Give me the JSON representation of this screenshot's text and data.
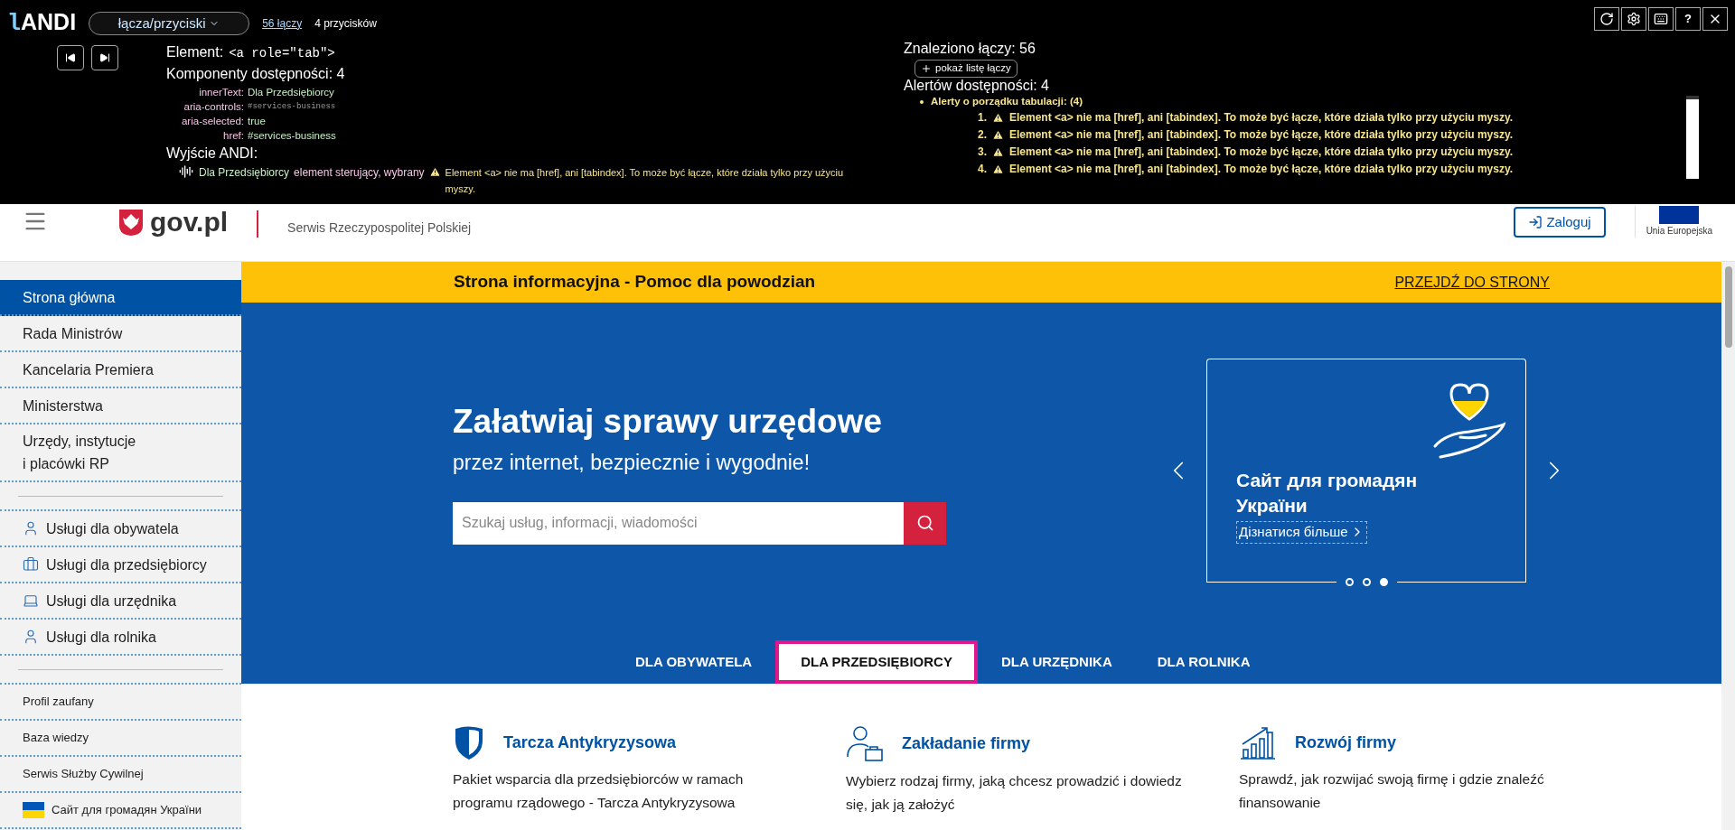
{
  "andi": {
    "logo_prefix": "l",
    "logo": "ANDI",
    "mode_dropdown": "łącza/przyciski",
    "links_count": "56 łączy",
    "buttons_count": "4 przycisków",
    "help_button": "?",
    "element_label": "Element:",
    "element_tag": "<a role=\"tab\">",
    "components_title": "Komponenty dostępności: 4",
    "properties": [
      {
        "name": "innerText:",
        "value": "Dla Przedsiębiorcy",
        "kind": "text"
      },
      {
        "name": "aria-controls:",
        "value": "#services-business",
        "kind": "code"
      },
      {
        "name": "aria-selected:",
        "value": "true",
        "kind": "text"
      },
      {
        "name": "href:",
        "value": "#services-business",
        "kind": "text"
      }
    ],
    "output_title": "Wyjście ANDI:",
    "output_name": "Dla Przedsiębiorcy",
    "output_role": "element sterujący, wybrany",
    "output_alert": "Element <a> nie ma [href], ani [tabindex]. To może być łącze, które działa tylko przy użyciu myszy.",
    "found": "Znaleziono łączy: 56",
    "show_list": "pokaż listę łączy",
    "alerts_title": "Alertów dostępności: 4",
    "alert_group": "Alerty o porządku tabulacji: (4)",
    "alerts": [
      {
        "number": "1.",
        "text": "Element <a> nie ma [href], ani [tabindex]. To może być łącze, które działa tylko przy użyciu myszy."
      },
      {
        "number": "2.",
        "text": "Element <a> nie ma [href], ani [tabindex]. To może być łącze, które działa tylko przy użyciu myszy."
      },
      {
        "number": "3.",
        "text": "Element <a> nie ma [href], ani [tabindex]. To może być łącze, które działa tylko przy użyciu myszy."
      },
      {
        "number": "4.",
        "text": "Element <a> nie ma [href], ani [tabindex]. To może być łącze, które działa tylko przy użyciu myszy."
      }
    ]
  },
  "header": {
    "logo": "gov.pl",
    "site_name": "Serwis Rzeczypospolitej Polskiej",
    "login": "Zaloguj",
    "eu": "Unia Europejska"
  },
  "sidebar": {
    "sections": [
      {
        "kind": "large",
        "items": [
          {
            "label": "Strona główna",
            "kind": "plain",
            "selected": true
          },
          {
            "label": "Rada Ministrów",
            "kind": "plain",
            "selected": false
          },
          {
            "label": "Kancelaria Premiera",
            "kind": "plain",
            "selected": false
          },
          {
            "label": "Ministerstwa",
            "kind": "plain",
            "selected": false
          },
          {
            "label": "Urzędy, instytucje\ni placówki RP",
            "kind": "plain",
            "selected": false
          }
        ]
      },
      {
        "kind": "large",
        "items": [
          {
            "label": "Usługi dla obywatela",
            "kind": "person",
            "selected": false
          },
          {
            "label": "Usługi dla przedsiębiorcy",
            "kind": "briefcase",
            "selected": false
          },
          {
            "label": "Usługi dla urzędnika",
            "kind": "laptop",
            "selected": false
          },
          {
            "label": "Usługi dla rolnika",
            "kind": "person",
            "selected": false
          }
        ]
      },
      {
        "kind": "small",
        "items": [
          {
            "label": "Profil zaufany",
            "kind": "plain",
            "selected": false
          },
          {
            "label": "Baza wiedzy",
            "kind": "plain",
            "selected": false
          },
          {
            "label": "Serwis Służby Cywilnej",
            "kind": "plain",
            "selected": false
          },
          {
            "label": "Сайт для громадян України",
            "kind": "flag",
            "selected": false
          }
        ]
      }
    ]
  },
  "banner": {
    "text": "Strona informacyjna - Pomoc dla powodzian",
    "link": "PRZEJDŹ DO STRONY"
  },
  "hero": {
    "title": "Załatwiaj sprawy urzędowe",
    "subtitle": "przez internet, bezpiecznie i wygodnie!",
    "search_placeholder": "Szukaj usług, informacji, wiadomości"
  },
  "carousel": {
    "title": "Сайт для громадян України",
    "link": "Дізнатися більше",
    "dots": [
      {
        "selected": false
      },
      {
        "selected": false
      },
      {
        "selected": true
      }
    ]
  },
  "tabs": [
    {
      "label": "DLA OBYWATELA",
      "selected": false
    },
    {
      "label": "DLA PRZEDSIĘBIORCY",
      "selected": true
    },
    {
      "label": "DLA URZĘDNIKA",
      "selected": false
    },
    {
      "label": "DLA ROLNIKA",
      "selected": false
    }
  ],
  "services": [
    {
      "kind": "shield",
      "title": "Tarcza Antykryzysowa",
      "description": "Pakiet wsparcia dla przedsiębiorców w ramach programu rządowego - Tarcza Antykryzysowa"
    },
    {
      "kind": "person-briefcase",
      "title": "Zakładanie firmy",
      "description": "Wybierz rodzaj firmy, jaką chcesz prowadzić i dowiedz się, jak ją założyć"
    },
    {
      "kind": "chart",
      "title": "Rozwój firmy",
      "description": "Sprawdź, jak rozwijać swoją firmę i gdzie znaleźć finansowanie"
    }
  ]
}
